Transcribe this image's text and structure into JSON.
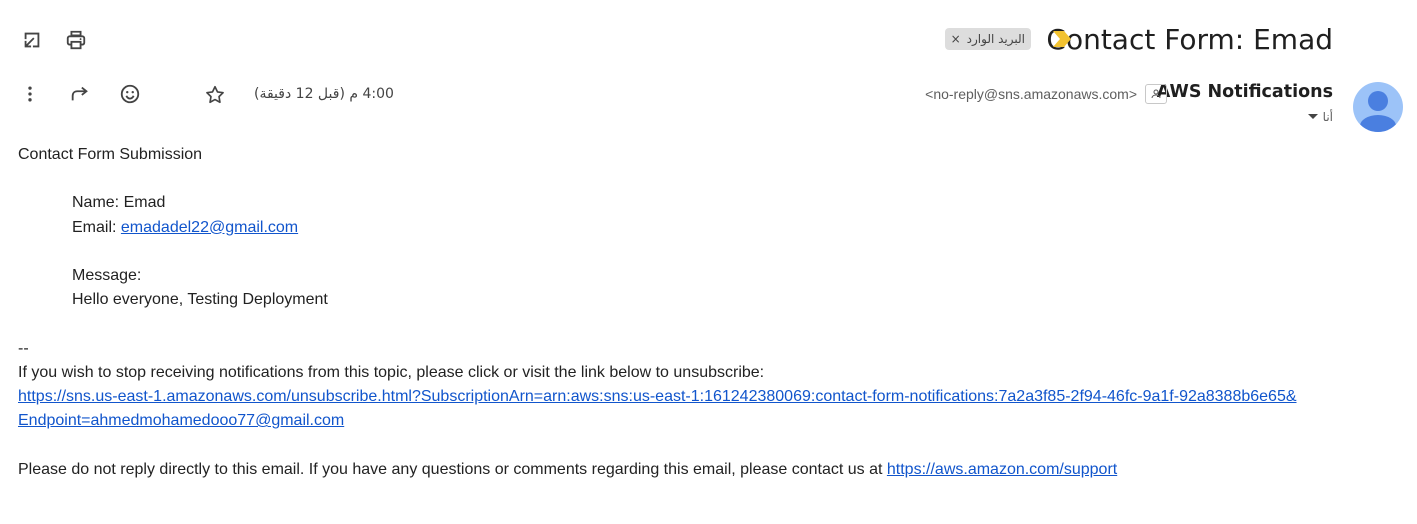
{
  "toolbar": {
    "open_new_window_icon": "open-in-new-window-icon",
    "print_icon": "print-icon"
  },
  "header": {
    "subject": "Contact Form: Emad",
    "label_chip": "البريد الوارد",
    "label_remove": "×"
  },
  "sender": {
    "name": "AWS Notifications",
    "email": "<no-reply@sns.amazonaws.com>",
    "to": "أنا"
  },
  "message_meta": {
    "timestamp": "4:00 م (قبل 12 دقيقة)"
  },
  "body": {
    "line1": "Contact Form Submission",
    "name_line": "Name: Emad",
    "email_label": "Email: ",
    "email_link": "emadadel22@gmail.com",
    "message_label": "Message:",
    "message_text": "Hello everyone, Testing Deployment",
    "separator": "--",
    "unsubscribe_intro": "If you wish to stop receiving notifications from this topic, please click or visit the link below to unsubscribe:",
    "unsubscribe_link_line1": "https://sns.us-east-1.amazonaws.com/unsubscribe.html?SubscriptionArn=arn:aws:sns:us-east-1:161242380069:contact-form-notifications:7a2a3f85-2f94-46fc-9a1f-92a8388b6e65&",
    "unsubscribe_link_line2": "Endpoint=ahmedmohamedooo77@gmail.com",
    "footer_text": "Please do not reply directly to this email. If you have any questions or comments regarding this email, please contact us at ",
    "footer_link": "https://aws.amazon.com/support"
  },
  "colors": {
    "link": "#1155cc",
    "important_marker": "#f2c230",
    "avatar_bg": "#9cc3f8",
    "avatar_fg": "#4a7fe0"
  }
}
